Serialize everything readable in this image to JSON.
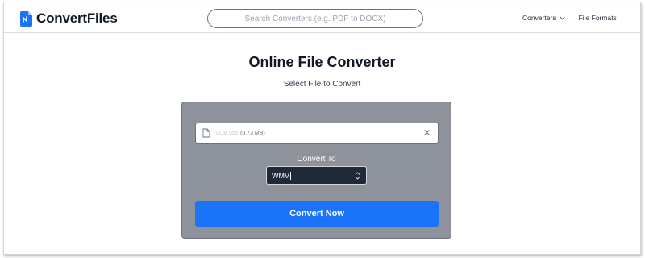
{
  "header": {
    "brand": "ConvertFiles",
    "search_placeholder": "Search Converters (e.g. PDF to DOCX)",
    "nav": [
      {
        "label": "Converters",
        "has_dropdown": true,
        "icon": "chevron-down-icon"
      },
      {
        "label": "File Formats",
        "has_dropdown": false
      }
    ]
  },
  "main": {
    "title": "Online File Converter",
    "subtitle": "Select File to Convert"
  },
  "file": {
    "name": "VOB.vob",
    "size": "(0.73 MB)",
    "icon": "file-icon",
    "remove_icon": "close-icon"
  },
  "convert": {
    "label": "Convert To",
    "selected": "WMV",
    "button": "Convert Now"
  },
  "colors": {
    "accent": "#1a73f8",
    "panel": "#8e939b",
    "select_bg": "#1f2937"
  }
}
